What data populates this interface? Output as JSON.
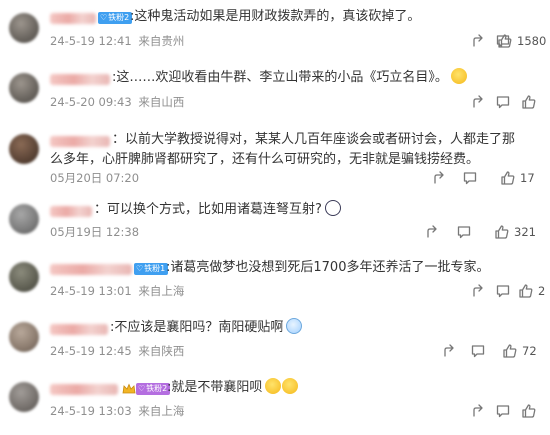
{
  "comments": [
    {
      "badge": "铁粉2",
      "text": ":这种鬼活动如果是用财政拨款弄的，真该砍掉了。",
      "date": "24-5-19 12:41",
      "location": "来自贵州",
      "likes": "1580"
    },
    {
      "badge": "",
      "text": ":这……欢迎收看由牛群、李立山带来的小品《巧立名目》。",
      "date": "24-5-20 09:43",
      "location": "来自山西",
      "likes": "",
      "emoji": "lightbulb-face-emoji"
    },
    {
      "badge": "",
      "text": "：以前大学教授说得对，某某人几百年座谈会或者研讨会，人都走了那么多年，心肝脾肺肾都研究了，还有什么可研究的，无非就是骗钱捞经费。",
      "date": "05月20日 07:20",
      "location": "",
      "likes": "17"
    },
    {
      "badge": "",
      "text": "：可以换个方式，比如用诸葛连弩互射?",
      "date": "05月19日 12:38",
      "location": "",
      "likes": "321",
      "emoji": "surprised-face-emoji"
    },
    {
      "badge": "铁粉1",
      "text": ":诸葛亮做梦也没想到死后1700多年还养活了一批专家。",
      "date": "24-5-19 13:01",
      "location": "来自上海",
      "likes": "2"
    },
    {
      "badge": "",
      "text": ":不应该是襄阳吗？南阳硬贴啊",
      "date": "24-5-19 12:45",
      "location": "来自陕西",
      "likes": "72",
      "emoji": "sweat-face-emoji"
    },
    {
      "badge": "铁粉2",
      "text": ":就是不带襄阳呗",
      "date": "24-5-19 13:03",
      "location": "来自上海",
      "likes": "",
      "emoji": "laughing-tears-emoji"
    }
  ],
  "colors": {
    "badge_blue": "#3f9ff0",
    "badge_purple": "#b46ee0",
    "meta_gray": "#8f8f8f"
  },
  "icons": [
    "share-icon",
    "comment-icon",
    "like-icon"
  ]
}
